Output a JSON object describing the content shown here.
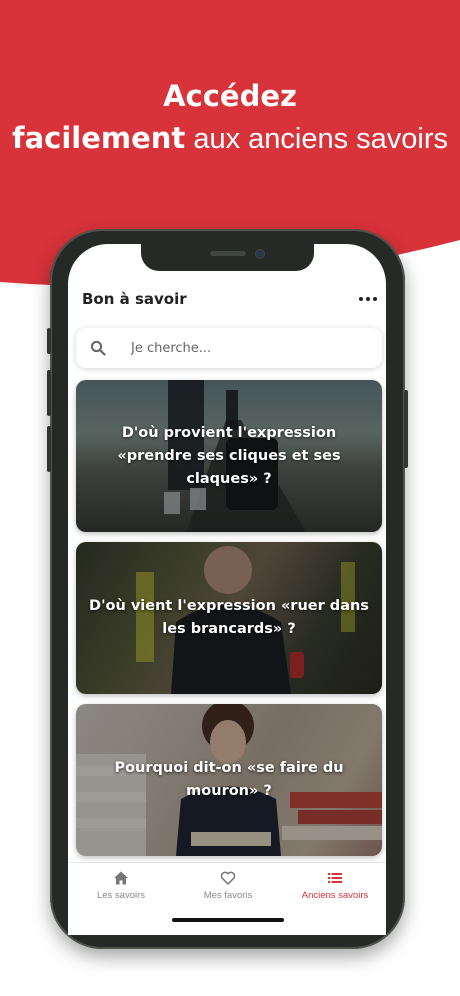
{
  "headline": {
    "line1": "Accédez",
    "line2_bold": "facilement",
    "line2_rest": " aux anciens savoirs"
  },
  "colors": {
    "brand_red": "#d8323a",
    "phone_frame": "#262a26"
  },
  "app": {
    "title": "Bon à savoir",
    "menu_icon": "more-horizontal-icon"
  },
  "search": {
    "placeholder": "Je cherche...",
    "value": "",
    "icon": "search-icon"
  },
  "cards": [
    {
      "title": "D'où provient l'expression «prendre ses cliques et ses claques» ?"
    },
    {
      "title": "D'où vient l'expression «ruer dans les brancards» ?"
    },
    {
      "title": "Pourquoi dit-on «se faire du mouron» ?"
    }
  ],
  "tabs": [
    {
      "label": "Les savoirs",
      "icon": "home-icon",
      "active": false
    },
    {
      "label": "Mes favoris",
      "icon": "heart-icon",
      "active": false
    },
    {
      "label": "Anciens savoirs",
      "icon": "list-icon",
      "active": true
    }
  ]
}
